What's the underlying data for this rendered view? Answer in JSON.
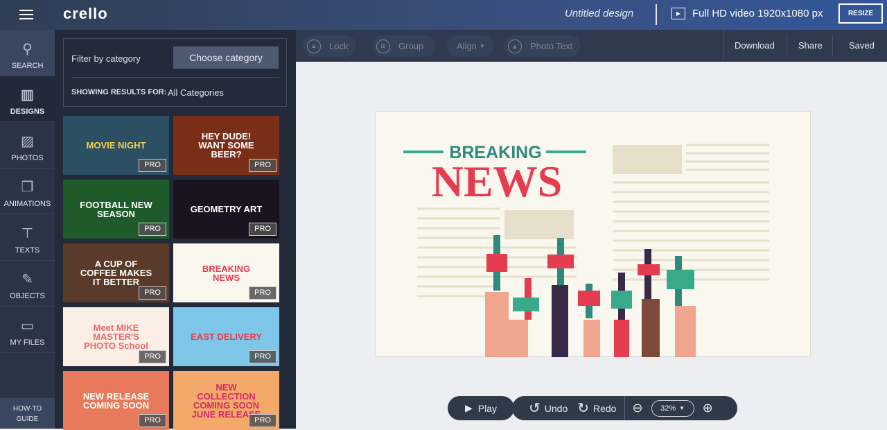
{
  "header": {
    "logo": "crello",
    "title": "Untitled design",
    "format": "Full HD video 1920x1080 px",
    "resize": "RESIZE"
  },
  "rail": [
    {
      "label": "SEARCH",
      "icon": "search-icon"
    },
    {
      "label": "DESIGNS",
      "icon": "designs-icon"
    },
    {
      "label": "PHOTOS",
      "icon": "photos-icon"
    },
    {
      "label": "ANIMATIONS",
      "icon": "animations-icon"
    },
    {
      "label": "TEXTS",
      "icon": "texts-icon"
    },
    {
      "label": "OBJECTS",
      "icon": "objects-icon"
    },
    {
      "label": "MY FILES",
      "icon": "files-icon"
    }
  ],
  "howto": {
    "line1": "HOW-TO",
    "line2": "GUIDE"
  },
  "filter": {
    "label": "Filter by category",
    "button": "Choose category",
    "showing_label": "SHOWING RESULTS FOR:",
    "showing_value": "All Categories"
  },
  "templates": [
    {
      "title": "MOVIE NIGHT",
      "badge": "PRO",
      "bg": "#2c4f63",
      "fg": "#f2d44a"
    },
    {
      "title": "HEY DUDE! WANT SOME BEER?",
      "badge": "PRO",
      "bg": "#7a2e17",
      "fg": "#ffffff"
    },
    {
      "title": "FOOTBALL NEW SEASON",
      "badge": "PRO",
      "bg": "#1f5a2a",
      "fg": "#ffffff"
    },
    {
      "title": "GEOMETRY ART",
      "badge": "PRO",
      "bg": "#1a1420",
      "fg": "#ffffff"
    },
    {
      "title": "A CUP OF COFFEE MAKES IT BETTER",
      "badge": "PRO",
      "bg": "#5a3a2a",
      "fg": "#ffffff"
    },
    {
      "title": "BREAKING NEWS",
      "badge": "PRO",
      "bg": "#faf7ef",
      "fg": "#e63c4f"
    },
    {
      "title": "Meet MIKE MASTER'S PHOTO School",
      "badge": "PRO",
      "bg": "#fbeee4",
      "fg": "#e56a6a"
    },
    {
      "title": "EAST DELIVERY",
      "badge": "PRO",
      "bg": "#7ec6e8",
      "fg": "#e63c4f"
    },
    {
      "title": "NEW RELEASE COMING SOON",
      "badge": "PRO",
      "bg": "#e77a5a",
      "fg": "#ffffff"
    },
    {
      "title": "NEW COLLECTION COMING SOON JUNE RELEASE",
      "badge": "PRO",
      "bg": "#f4a86a",
      "fg": "#d02a6a"
    }
  ],
  "toolbar": {
    "lock": "Lock",
    "group": "Group",
    "align": "Align",
    "photo_text": "Photo Text",
    "download": "Download",
    "share": "Share",
    "saved": "Saved"
  },
  "canvas": {
    "headline_top": "BREAKING",
    "headline_main": "NEWS"
  },
  "bottom": {
    "play": "Play",
    "undo": "Undo",
    "redo": "Redo",
    "zoom": "32%"
  }
}
